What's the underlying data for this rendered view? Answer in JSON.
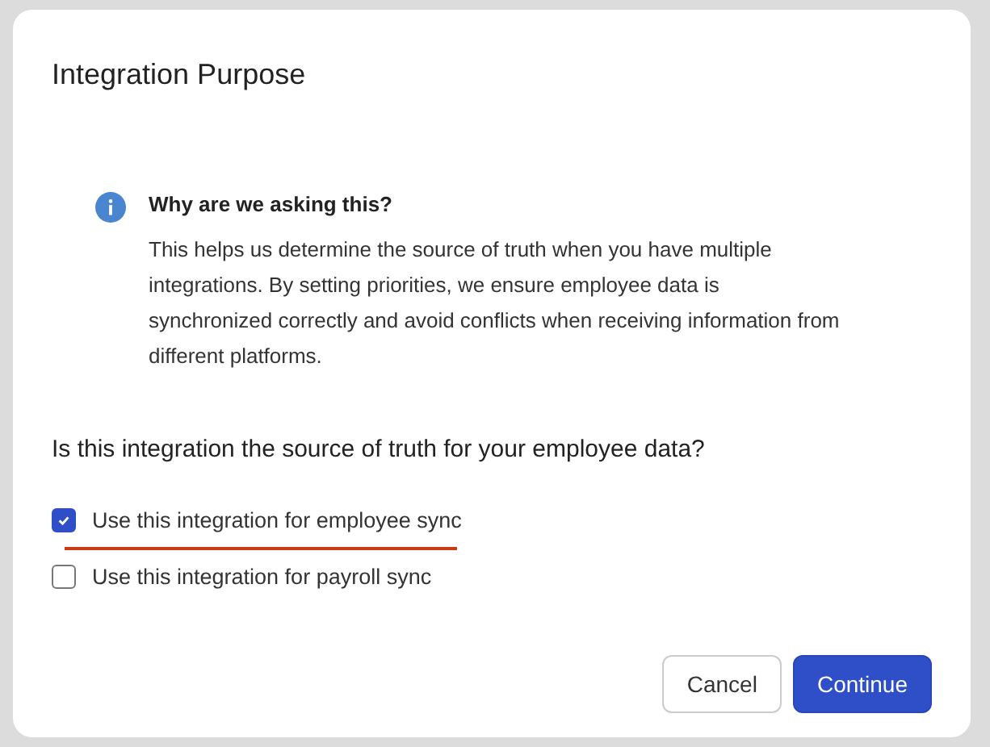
{
  "dialog": {
    "title": "Integration Purpose",
    "info": {
      "heading": "Why are we asking this?",
      "body": "This helps us determine the source of truth when you have multiple integrations. By setting priorities, we ensure employee data is synchronized correctly and avoid conflicts when receiving information from different platforms."
    },
    "question": "Is this integration the source of truth for your employee data?",
    "options": [
      {
        "label": "Use this integration for employee sync",
        "checked": true,
        "underlined": true
      },
      {
        "label": "Use this integration for payroll sync",
        "checked": false,
        "underlined": false
      }
    ],
    "buttons": [
      {
        "label": "Cancel",
        "kind": "secondary"
      },
      {
        "label": "Continue",
        "kind": "primary"
      }
    ]
  }
}
